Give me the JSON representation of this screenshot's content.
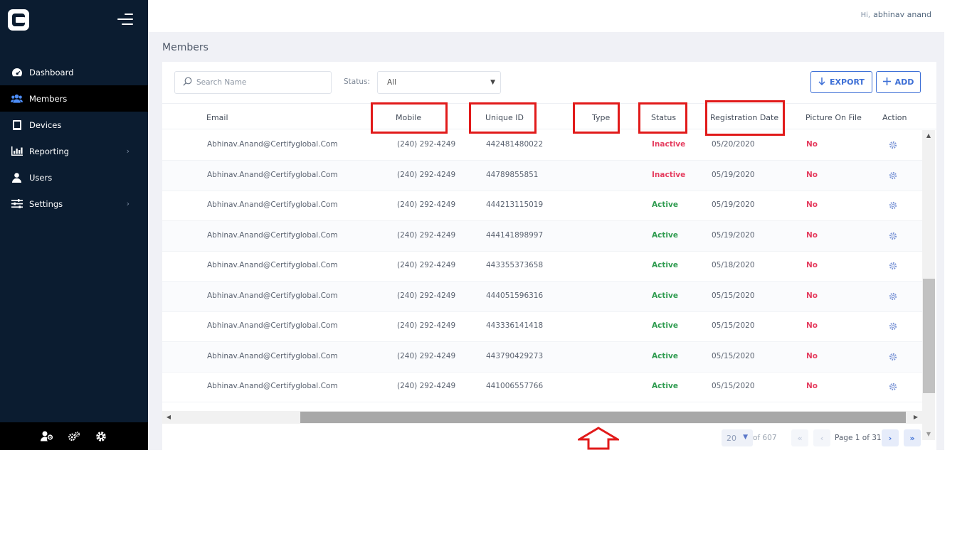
{
  "header": {
    "greeting": "Hi,",
    "user_name": "abhinav anand"
  },
  "sidebar": {
    "items": [
      {
        "label": "Dashboard",
        "icon": "dashboard-icon"
      },
      {
        "label": "Members",
        "icon": "members-icon",
        "active": true
      },
      {
        "label": "Devices",
        "icon": "devices-icon"
      },
      {
        "label": "Reporting",
        "icon": "reporting-icon",
        "has_submenu": true
      },
      {
        "label": "Users",
        "icon": "user-icon"
      },
      {
        "label": "Settings",
        "icon": "settings-sliders-icon",
        "has_submenu": true
      }
    ],
    "footer_icons": [
      "user-settings-icon",
      "gears-icon",
      "gear-icon"
    ]
  },
  "page": {
    "title": "Members"
  },
  "filters": {
    "search_placeholder": "Search Name",
    "status_label": "Status:",
    "status_value": "All"
  },
  "toolbar": {
    "export_label": "EXPORT",
    "add_label": "ADD"
  },
  "table": {
    "columns": [
      "Email",
      "Mobile",
      "Unique ID",
      "Type",
      "Status",
      "Registration Date",
      "Picture On File",
      "Action"
    ],
    "rows": [
      {
        "email": "Abhinav.Anand@Certifyglobal.Com",
        "mobile": "(240) 292-4249",
        "uid": "442481480022",
        "type": "",
        "status": "Inactive",
        "date": "05/20/2020",
        "picture": "No"
      },
      {
        "email": "Abhinav.Anand@Certifyglobal.Com",
        "mobile": "(240) 292-4249",
        "uid": "44789855851",
        "type": "",
        "status": "Inactive",
        "date": "05/19/2020",
        "picture": "No"
      },
      {
        "email": "Abhinav.Anand@Certifyglobal.Com",
        "mobile": "(240) 292-4249",
        "uid": "444213115019",
        "type": "",
        "status": "Active",
        "date": "05/19/2020",
        "picture": "No"
      },
      {
        "email": "Abhinav.Anand@Certifyglobal.Com",
        "mobile": "(240) 292-4249",
        "uid": "444141898997",
        "type": "",
        "status": "Active",
        "date": "05/19/2020",
        "picture": "No"
      },
      {
        "email": "Abhinav.Anand@Certifyglobal.Com",
        "mobile": "(240) 292-4249",
        "uid": "443355373658",
        "type": "",
        "status": "Active",
        "date": "05/18/2020",
        "picture": "No"
      },
      {
        "email": "Abhinav.Anand@Certifyglobal.Com",
        "mobile": "(240) 292-4249",
        "uid": "444051596316",
        "type": "",
        "status": "Active",
        "date": "05/15/2020",
        "picture": "No"
      },
      {
        "email": "Abhinav.Anand@Certifyglobal.Com",
        "mobile": "(240) 292-4249",
        "uid": "443336141418",
        "type": "",
        "status": "Active",
        "date": "05/15/2020",
        "picture": "No"
      },
      {
        "email": "Abhinav.Anand@Certifyglobal.Com",
        "mobile": "(240) 292-4249",
        "uid": "443790429273",
        "type": "",
        "status": "Active",
        "date": "05/15/2020",
        "picture": "No"
      },
      {
        "email": "Abhinav.Anand@Certifyglobal.Com",
        "mobile": "(240) 292-4249",
        "uid": "441006557766",
        "type": "",
        "status": "Active",
        "date": "05/15/2020",
        "picture": "No"
      }
    ],
    "highlighted_columns": [
      "Mobile",
      "Unique ID",
      "Type",
      "Status",
      "Registration Date"
    ]
  },
  "pagination": {
    "page_size": "20",
    "total_text": "of 607",
    "page_info": "Page 1 of 31"
  },
  "colors": {
    "sidebar_bg": "#0b1c30",
    "accent": "#3d6fd6",
    "inactive": "#e53d5f",
    "active": "#2e9b4f",
    "annotation": "#e11a1a"
  }
}
